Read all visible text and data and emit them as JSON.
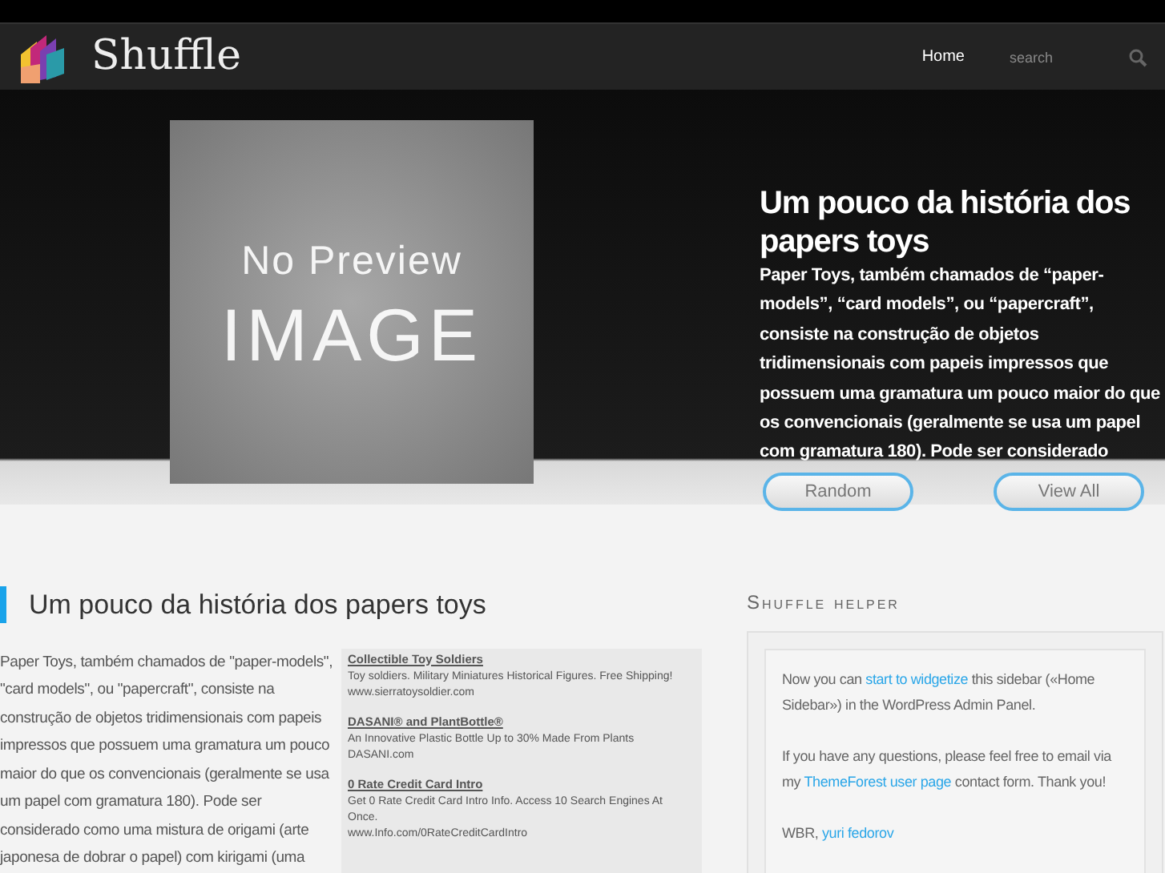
{
  "header": {
    "logo_text": "Shuffle",
    "nav": [
      {
        "label": "Home",
        "selected": true
      }
    ],
    "search": {
      "placeholder": "search"
    }
  },
  "hero": {
    "preview": {
      "line1": "No Preview",
      "line2": "IMAGE"
    },
    "title": "Um pouco da história dos papers toys",
    "text": "Paper Toys, também chamados de “paper-models”, “card models”, ou “papercraft”, consiste na construção de objetos tridimensionais com papeis impressos que possuem uma gramatura um pouco maior do que os convencionais (geralmente se usa um papel com gramatura 180). Pode ser considerado",
    "buttons": [
      "Random",
      "View All"
    ]
  },
  "post": {
    "title": "Um pouco da história dos papers toys",
    "text": "Paper Toys, também chamados de \"paper-models\", \"card models\", ou \"papercraft\", consiste na construção de objetos tridimensionais com papeis impressos que possuem uma gramatura um pouco maior do que os convencionais (geralmente se usa um papel com gramatura 180). Pode ser considerado como uma mistura de origami (arte japonesa de dobrar o papel) com kirigami (uma",
    "ads": [
      {
        "title": "Collectible Toy Soldiers",
        "text": "Toy soldiers. Military Miniatures Historical Figures. Free Shipping!",
        "url": "www.sierratoysoldier.com"
      },
      {
        "title": "DASANI® and PlantBottle®",
        "text": "An Innovative Plastic Bottle Up to 30% Made From Plants",
        "url": "DASANI.com"
      },
      {
        "title": "0 Rate Credit Card Intro",
        "text": "Get 0 Rate Credit Card Intro Info. Access 10 Search Engines At Once.",
        "url": "www.Info.com/0RateCreditCardIntro"
      }
    ]
  },
  "sidebar": {
    "title": "Shuffle helper",
    "paragraphs": [
      [
        {
          "text": "Now you can "
        },
        {
          "text": "start to widgetize",
          "link": true
        },
        {
          "text": " this sidebar («Home Sidebar») in the WordPress Admin Panel."
        }
      ],
      [
        {
          "text": "If you have any questions, please feel free to email via my "
        },
        {
          "text": "ThemeForest user page",
          "link": true
        },
        {
          "text": " contact form. Thank you!"
        }
      ],
      [
        {
          "text": "WBR, "
        },
        {
          "text": "yuri fedorov",
          "link": true
        }
      ]
    ]
  }
}
